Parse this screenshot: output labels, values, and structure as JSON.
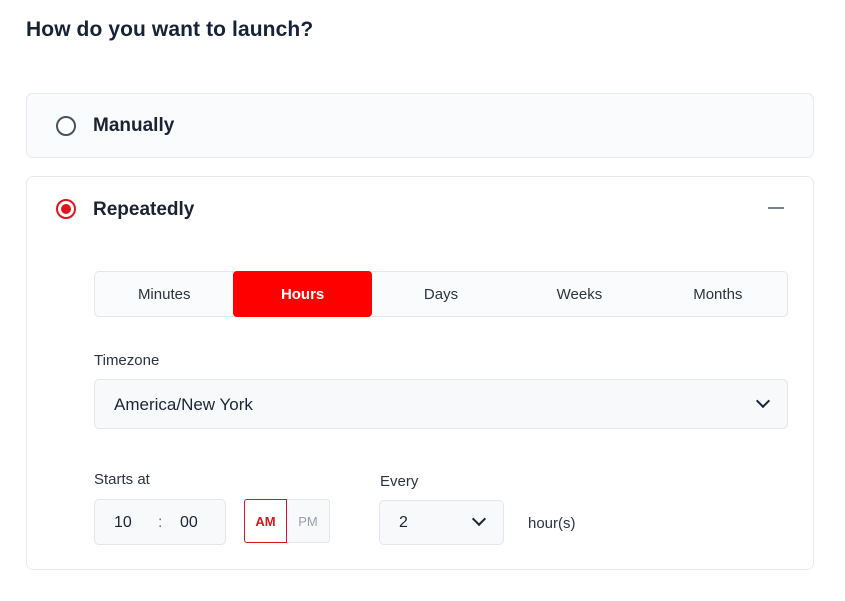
{
  "page": {
    "title": "How do you want to launch?"
  },
  "launch_options": {
    "manual": {
      "label": "Manually",
      "selected": false
    },
    "repeat": {
      "label": "Repeatedly",
      "selected": true,
      "expanded": true
    }
  },
  "frequency": {
    "tabs": [
      "Minutes",
      "Hours",
      "Days",
      "Weeks",
      "Months"
    ],
    "active": "Hours"
  },
  "timezone": {
    "label": "Timezone",
    "value": "America/New York"
  },
  "starts_at": {
    "label": "Starts at",
    "hour": "10",
    "separator": ":",
    "minute": "00",
    "am": "AM",
    "pm": "PM",
    "period": "AM"
  },
  "every": {
    "label": "Every",
    "value": "2",
    "unit": "hour(s)"
  },
  "colors": {
    "accent": "#ff0000",
    "radio_selected": "#e0141e",
    "heading": "#152238"
  }
}
